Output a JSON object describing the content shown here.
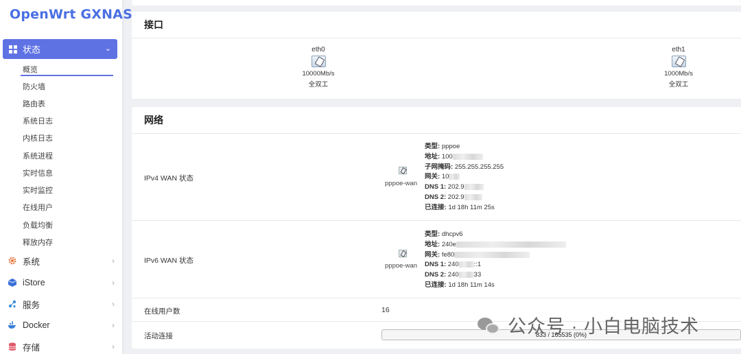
{
  "brand": "OpenWrt GXNAS",
  "sidebar": {
    "active": {
      "label": "状态",
      "icon": "dashboard-grid-icon"
    },
    "sub_items": [
      "概览",
      "防火墙",
      "路由表",
      "系统日志",
      "内核日志",
      "系统进程",
      "实时信息",
      "实时监控",
      "在线用户",
      "负载均衡",
      "释放内存"
    ],
    "top_items": [
      {
        "label": "系统",
        "icon": "gear-icon",
        "color": "#e8743b"
      },
      {
        "label": "iStore",
        "icon": "cube-icon",
        "color": "#3b6fd8"
      },
      {
        "label": "服务",
        "icon": "share-icon",
        "color": "#3b8fd8"
      },
      {
        "label": "Docker",
        "icon": "docker-whale-icon",
        "color": "#3b7fd8"
      },
      {
        "label": "存储",
        "icon": "database-icon",
        "color": "#e05a6a"
      }
    ]
  },
  "interfaces": {
    "title": "接口",
    "ports": [
      {
        "name": "eth0",
        "speed": "10000Mb/s",
        "duplex": "全双工"
      },
      {
        "name": "eth1",
        "speed": "1000Mb/s",
        "duplex": "全双工"
      }
    ]
  },
  "network": {
    "title": "网络",
    "ipv4": {
      "label": "IPv4 WAN 状态",
      "iface": "pppoe-wan",
      "type_k": "类型:",
      "type_v": "pppoe",
      "addr_k": "地址:",
      "addr_v": "100",
      "mask_k": "子网掩码:",
      "mask_v": "255.255.255.255",
      "gw_k": "网关:",
      "gw_v": "10",
      "dns1_k": "DNS 1:",
      "dns1_v": "202.9",
      "dns2_k": "DNS 2:",
      "dns2_v": "202.9",
      "up_k": "已连接:",
      "up_v": "1d 18h 11m 25s"
    },
    "ipv6": {
      "label": "IPv6 WAN 状态",
      "iface": "pppoe-wan",
      "type_k": "类型:",
      "type_v": "dhcpv6",
      "addr_k": "地址:",
      "addr_v": "240e",
      "gw_k": "网关:",
      "gw_v": "fe80",
      "dns1_k": "DNS 1:",
      "dns1_v": "240",
      "dns1_tail": "::1",
      "dns2_k": "DNS 2:",
      "dns2_v": "240",
      "dns2_tail": "33",
      "up_k": "已连接:",
      "up_v": "1d 18h 11m 14s"
    },
    "online_users_label": "在线用户数",
    "online_users_value": "16",
    "active_conn_label": "活动连接",
    "active_conn_text": "833 / 165535 (0%)",
    "active_conn_fraction": 0.005
  },
  "watermark": "公众号 · 小白电脑技术"
}
